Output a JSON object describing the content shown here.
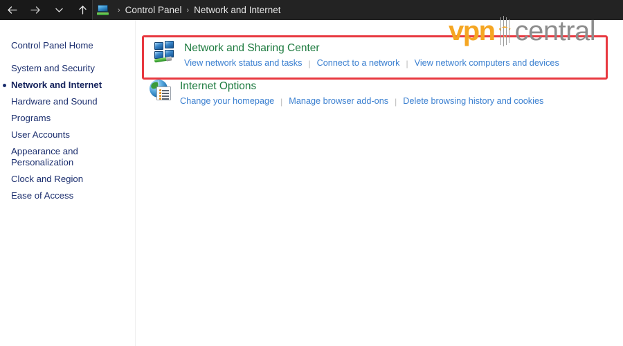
{
  "titlebar": {
    "nav": {
      "back_label": "Back",
      "forward_label": "Forward",
      "recent_label": "Recent locations",
      "up_label": "Up one level"
    },
    "breadcrumb": {
      "icon": "control-panel-icon",
      "separator": "›",
      "items": [
        {
          "label": "Control Panel"
        },
        {
          "label": "Network and Internet"
        }
      ]
    }
  },
  "sidebar": {
    "home": {
      "label": "Control Panel Home"
    },
    "items": [
      {
        "label": "System and Security",
        "selected": false
      },
      {
        "label": "Network and Internet",
        "selected": true
      },
      {
        "label": "Hardware and Sound",
        "selected": false
      },
      {
        "label": "Programs",
        "selected": false
      },
      {
        "label": "User Accounts",
        "selected": false
      },
      {
        "label": "Appearance and Personalization",
        "selected": false
      },
      {
        "label": "Clock and Region",
        "selected": false
      },
      {
        "label": "Ease of Access",
        "selected": false
      }
    ]
  },
  "main": {
    "categories": [
      {
        "icon": "network-sharing-center-icon",
        "title": "Network and Sharing Center",
        "links": [
          "View network status and tasks",
          "Connect to a network",
          "View network computers and devices"
        ]
      },
      {
        "icon": "internet-options-icon",
        "title": "Internet Options",
        "links": [
          "Change your homepage",
          "Manage browser add-ons",
          "Delete browsing history and cookies"
        ]
      }
    ],
    "link_separator": "|"
  },
  "highlight": {
    "color": "#e8383f",
    "target": "Network and Sharing Center"
  },
  "watermark": {
    "text_primary": "vpn",
    "text_secondary": "central",
    "color_primary": "#f5a623",
    "color_secondary": "#8d8d8d"
  }
}
